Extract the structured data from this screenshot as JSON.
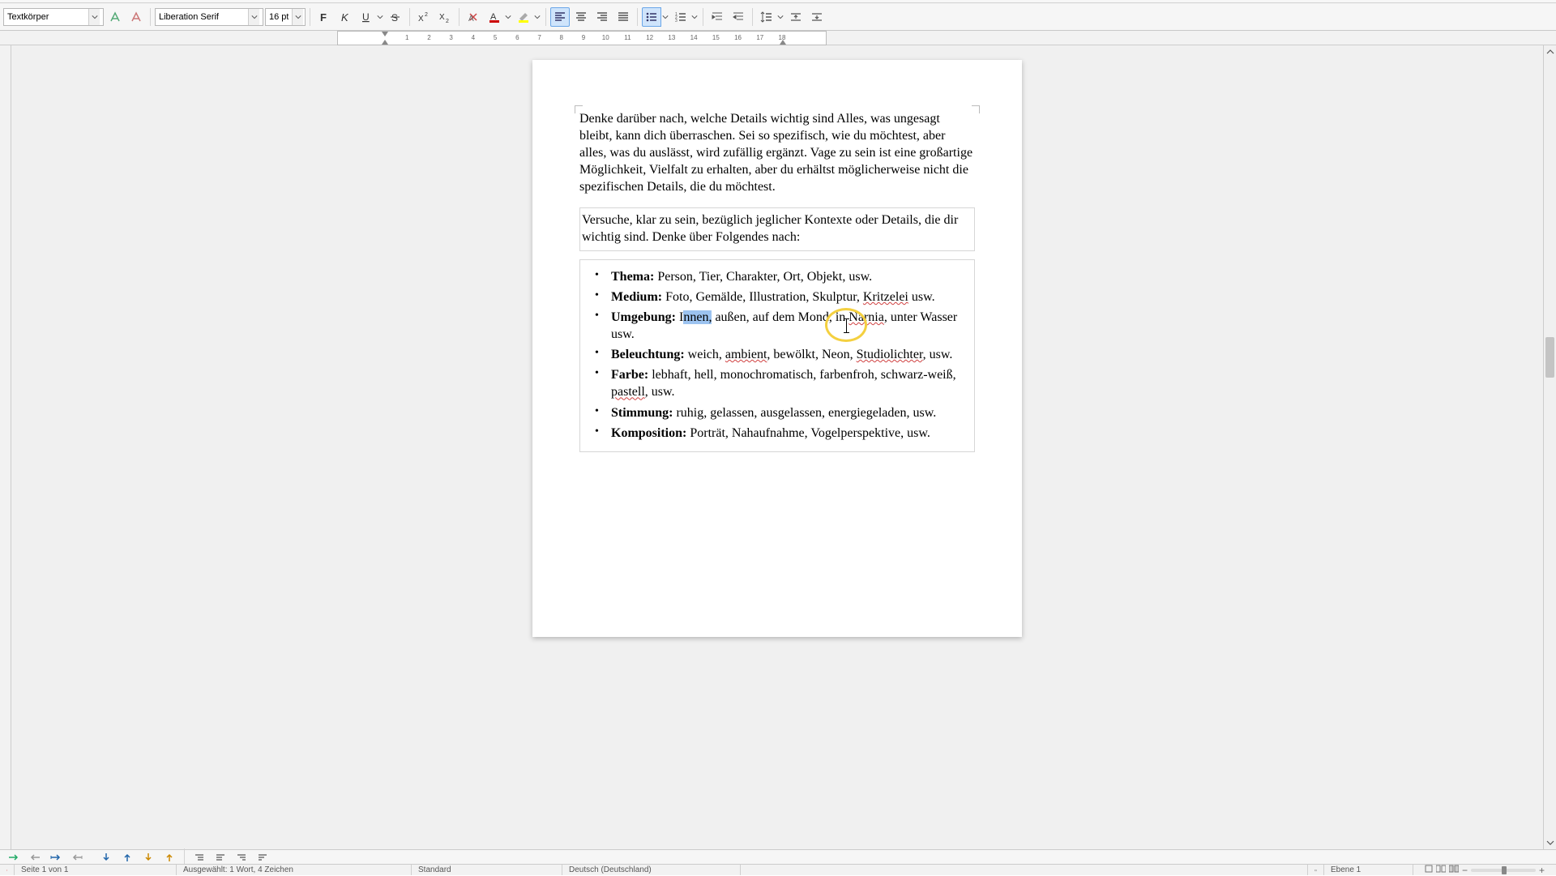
{
  "toolbar": {
    "style_name": "Textkörper",
    "font_name": "Liberation Serif",
    "font_size": "16 pt"
  },
  "ruler": {
    "numbers": [
      "1",
      "2",
      "3",
      "4",
      "5",
      "6",
      "7",
      "8",
      "9",
      "10",
      "11",
      "12",
      "13",
      "14",
      "15",
      "16",
      "17",
      "18"
    ]
  },
  "document": {
    "para1": "Denke darüber nach, welche Details wichtig sind Alles, was ungesagt bleibt, kann dich überraschen. Sei so spezifisch, wie du möchtest, aber alles, was du auslässt, wird zufällig ergänzt. Vage zu sein ist eine großartige Möglichkeit, Vielfalt zu erhalten, aber du erhältst möglicherweise nicht die spezifischen Details, die du möchtest.",
    "para2": "Versuche, klar zu sein, bezüglich jeglicher Kontexte oder Details, die dir wichtig sind. Denke über Folgendes nach:",
    "items": {
      "thema": {
        "label": "Thema:",
        "text": " Person, Tier, Charakter, Ort, Objekt, usw."
      },
      "medium": {
        "label": "Medium:",
        "text_a": " Foto, Gemälde, Illustration, Skulptur, ",
        "kritzelei": "Kritzelei",
        "text_b": " usw."
      },
      "umgebung": {
        "label": "Umgebung:",
        "pre_sel": " I",
        "sel": "nnen,",
        "post_sel": " außen, auf dem Mond, in ",
        "narnia": "Narnia",
        "tail": ", unter Wasser usw."
      },
      "beleuchtung": {
        "label": "Beleuchtung:",
        "a": " weich, ",
        "ambient": "ambient",
        "b": ", bewölkt, Neon, ",
        "studio": "Studiolichter",
        "c": ", usw."
      },
      "farbe": {
        "label": "Farbe:",
        "a": " lebhaft, hell, monochromatisch, farbenfroh, schwarz-weiß, ",
        "pastell": "pastell",
        "b": ", usw."
      },
      "stimmung": {
        "label": "Stimmung:",
        "text": " ruhig, gelassen, ausgelassen, energiegeladen, usw."
      },
      "komposition": {
        "label": "Komposition:",
        "text": " Porträt, Nahaufnahme, Vogelperspektive, usw."
      }
    }
  },
  "status": {
    "page": "Seite 1 von 1",
    "selection": "Ausgewählt: 1 Wort, 4 Zeichen",
    "page_style": "Standard",
    "language": "Deutsch (Deutschland)",
    "zoom_label": "Ebene 1"
  }
}
